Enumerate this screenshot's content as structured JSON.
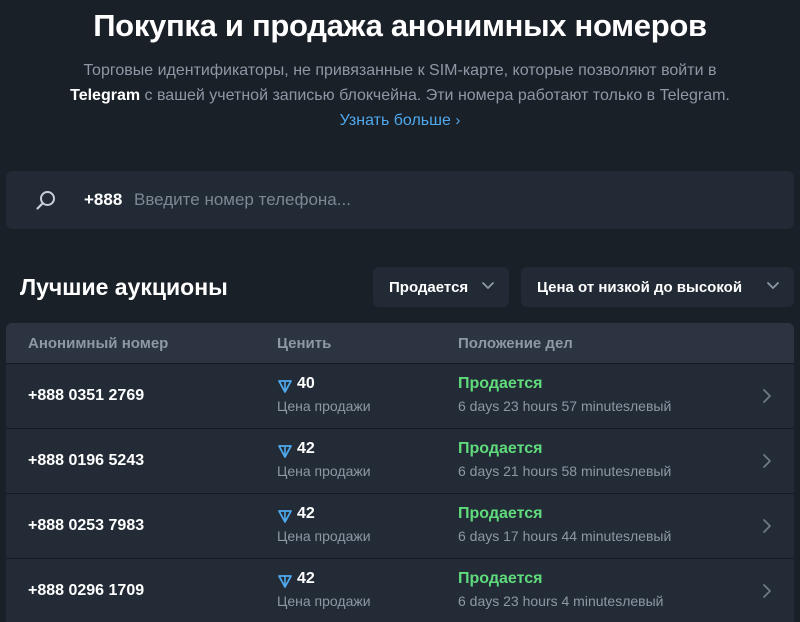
{
  "header": {
    "title": "Покупка и продажа анонимных номеров",
    "desc_part1": "Торговые идентификаторы, не привязанные к SIM-карте, которые позволяют войти в ",
    "desc_bold": "Telegram",
    "desc_part2": " с вашей учетной записью блокчейна. Эти номера работают только в Telegram. ",
    "learn_more": "Узнать больше",
    "learn_more_chevron": "›"
  },
  "search": {
    "prefix": "+888",
    "placeholder": "Введите номер телефона...",
    "value": "",
    "icon": "search-icon"
  },
  "auctions": {
    "title": "Лучшие аукционы",
    "status_filter": "Продается",
    "sort_filter": "Цена от низкой до высокой"
  },
  "table": {
    "columns": [
      "Анонимный номер",
      "Ценить",
      "Положение дел"
    ],
    "rows": [
      {
        "number": "+888 0351 2769",
        "price": "40",
        "price_label": "Цена продажи",
        "status": "Продается",
        "time_left": "6 days 23 hours 57 minutesлевый"
      },
      {
        "number": "+888 0196 5243",
        "price": "42",
        "price_label": "Цена продажи",
        "status": "Продается",
        "time_left": "6 days 21 hours 58 minutesлевый"
      },
      {
        "number": "+888 0253 7983",
        "price": "42",
        "price_label": "Цена продажи",
        "status": "Продается",
        "time_left": "6 days 17 hours 44 minutesлевый"
      },
      {
        "number": "+888 0296 1709",
        "price": "42",
        "price_label": "Цена продажи",
        "status": "Продается",
        "time_left": "6 days 23 hours 4 minutesлевый"
      }
    ]
  },
  "colors": {
    "background": "#1a2028",
    "panel": "#222b35",
    "accent_link": "#4fa9ee",
    "status_green": "#5fdb7c",
    "muted_text": "#8e98a5"
  },
  "icons": {
    "currency": "ton-icon",
    "row_action": "chevron-right-icon",
    "dropdown": "chevron-down-icon"
  }
}
